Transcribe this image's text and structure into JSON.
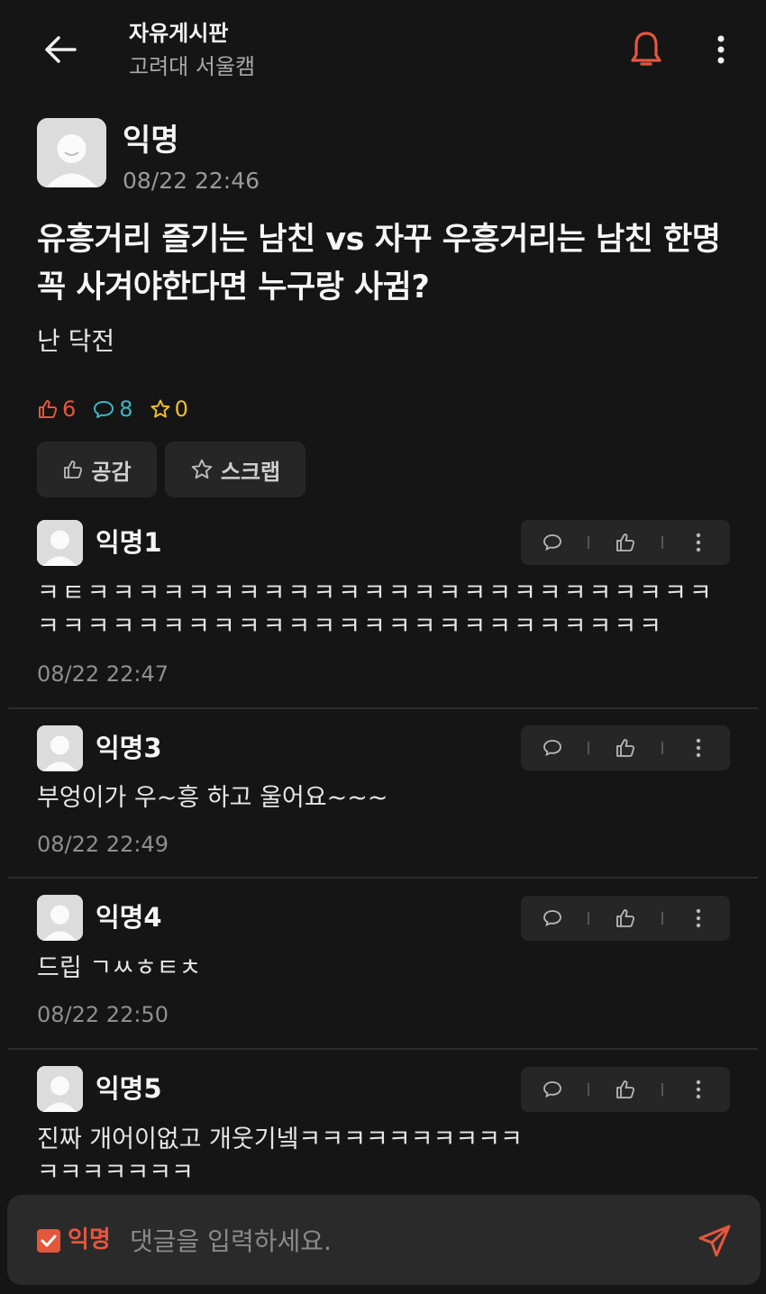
{
  "header": {
    "board_title": "자유게시판",
    "board_subtitle": "고려대 서울캠",
    "back_icon": "arrow-left-icon",
    "bell_icon": "bell-icon",
    "more_icon": "more-vertical-icon"
  },
  "post": {
    "author": "익명",
    "time": "08/22 22:46",
    "title": "유흥거리 즐기는 남친 vs 자꾸 우흥거리는 남친 한명 꼭 사겨야한다면 누구랑 사귐?",
    "body": "난 닥전",
    "stats": {
      "likes": "6",
      "comments": "8",
      "scraps": "0"
    },
    "like_button": "공감",
    "scrap_button": "스크랩"
  },
  "comments": [
    {
      "author": "익명1",
      "text": "ㅋㅌㅋㅋㅋㅋㅋㅋㅋㅋㅋㅋㅋㅋㅋㅋㅋㅋㅋㅋㅋㅋㅋㅋㅋㅋㅋㅋㅋㅋㅋㅋㅋㅋㅋㅋㅋㅋㅋㅋㅋㅋㅋㅋㅋㅋㅋㅋㅋㅋㅋㅋ",
      "time": "08/22 22:47"
    },
    {
      "author": "익명3",
      "text": "부엉이가 우~흥 하고 울어요~~~",
      "time": "08/22 22:49"
    },
    {
      "author": "익명4",
      "text": "드립 ㄱㅆㅎㅌㅊ",
      "time": "08/22 22:50"
    },
    {
      "author": "익명5",
      "text": "진짜 개어이없고 개웃기넼ㅋㅋㅋㅋㅋㅋㅋㅋㅋㅋㅋㅋㅋㅋㅋㅋㅋ",
      "time": ""
    }
  ],
  "input_bar": {
    "anon_label": "익명",
    "placeholder": "댓글을 입력하세요.",
    "send_icon": "send-icon"
  },
  "colors": {
    "background": "#151515",
    "accent": "#e4573d",
    "comment_stat": "#40b3c4",
    "scrap_stat": "#efbd2b",
    "card": "#262626"
  }
}
